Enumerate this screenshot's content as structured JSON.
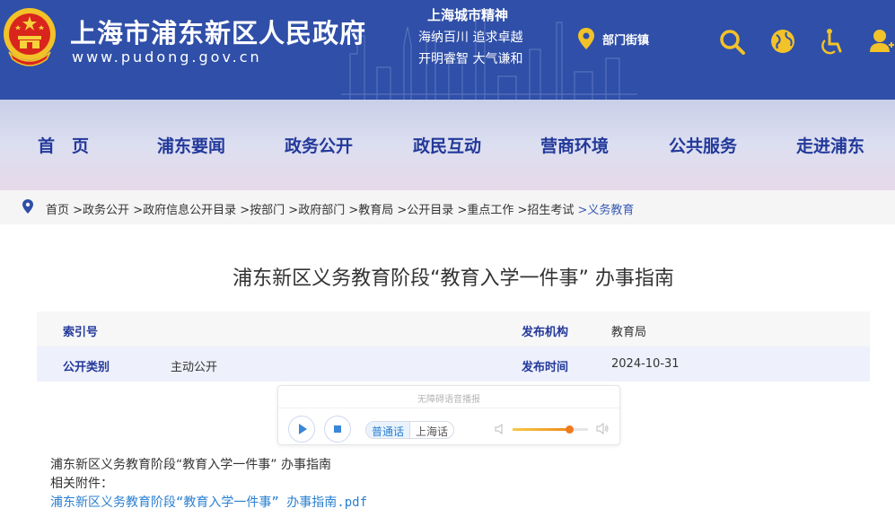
{
  "header": {
    "site_title": "上海市浦东新区人民政府",
    "site_url": "www.pudong.gov.cn",
    "spirit_title": "上海城市精神",
    "spirit_line1": "海纳百川 追求卓越",
    "spirit_line2": "开明睿智 大气谦和",
    "dept_link": "部门街镇",
    "tools": [
      "search-icon",
      "globe-icon",
      "accessibility-icon",
      "user-icon"
    ],
    "brand_color": "#2f4fa8"
  },
  "nav": {
    "items": [
      "首　页",
      "浦东要闻",
      "政务公开",
      "政民互动",
      "营商环境",
      "公共服务",
      "走进浦东"
    ],
    "color": "#23399a"
  },
  "breadcrumb": {
    "items": [
      "首页",
      ">政务公开",
      ">政府信息公开目录",
      ">按部门",
      ">政府部门",
      ">教育局",
      ">公开目录",
      ">重点工作",
      ">招生考试",
      ">义务教育"
    ]
  },
  "article": {
    "title": "浦东新区义务教育阶段“教育入学一件事”  办事指南",
    "meta": {
      "index_label": "索引号",
      "index_value": "",
      "publisher_label": "发布机构",
      "publisher_value": "教育局",
      "category_label": "公开类别",
      "category_value": "主动公开",
      "date_label": "发布时间",
      "date_value": "2024-10-31"
    },
    "body_line1": "浦东新区义务教育阶段“教育入学一件事”  办事指南",
    "attachment_label": "相关附件：",
    "attachment_link": "浦东新区义务教育阶段“教育入学一件事”  办事指南.pdf"
  },
  "player": {
    "hint": "无障碍语音播报",
    "lang_active": "普通话",
    "lang_other": "上海话",
    "volume": 0.75
  }
}
